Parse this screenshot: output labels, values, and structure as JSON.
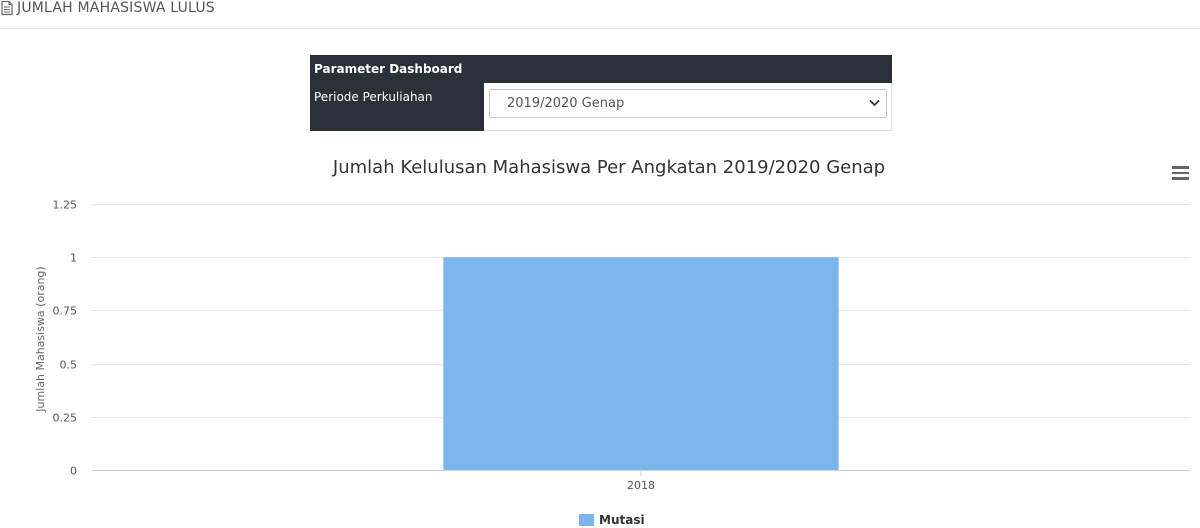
{
  "page": {
    "title": "JUMLAH MAHASISWA LULUS",
    "title_icon": "document-icon"
  },
  "parameter_panel": {
    "heading": "Parameter Dashboard",
    "period_label": "Periode Perkuliahan",
    "period_value": "2019/2020 Genap"
  },
  "chart_menu": {
    "icon": "hamburger-menu-icon"
  },
  "chart_data": {
    "type": "bar",
    "title": "Jumlah Kelulusan Mahasiswa Per Angkatan 2019/2020 Genap",
    "xlabel": "",
    "ylabel": "Jumlah Mahasiswa (orang)",
    "categories": [
      "2018"
    ],
    "series": [
      {
        "name": "Mutasi",
        "values": [
          1
        ],
        "color": "#7cb5ec"
      }
    ],
    "ylim": [
      0,
      1.25
    ],
    "yticks": [
      "0",
      "0.25",
      "0.5",
      "0.75",
      "1",
      "1.25"
    ],
    "grid": true,
    "legend": "bottom-center"
  }
}
